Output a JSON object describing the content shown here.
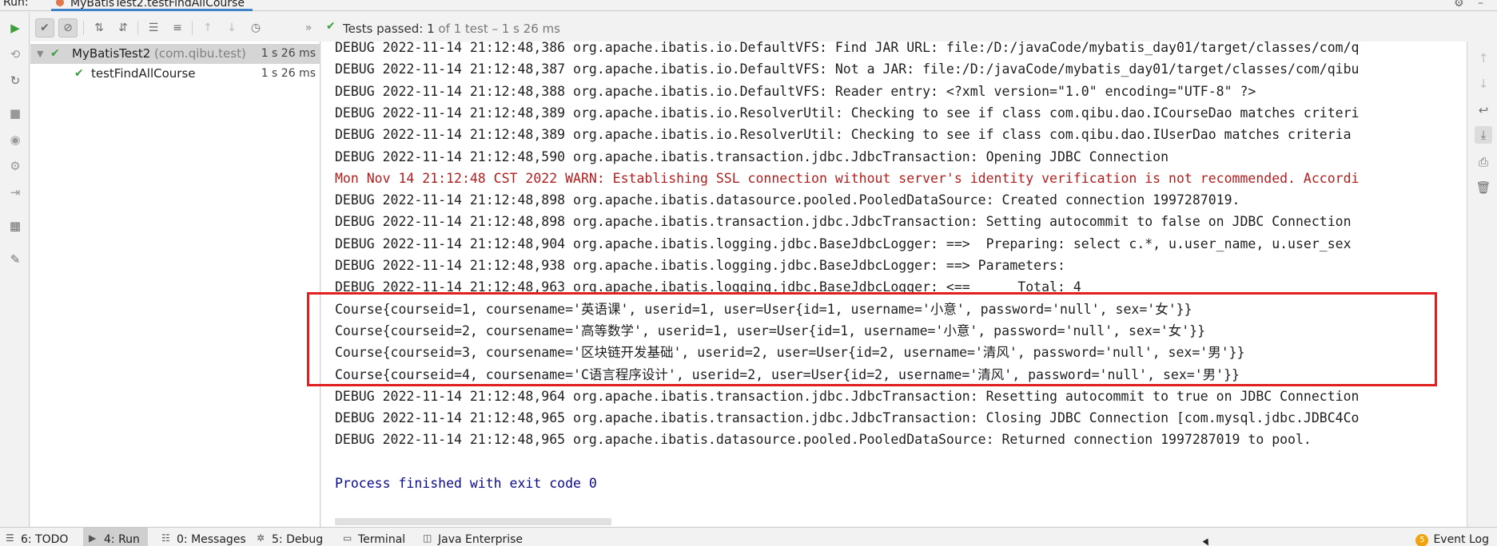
{
  "window": {
    "run_label": "Run:",
    "tab_title": "MyBatisTest2.testFindAllCourse"
  },
  "toolbar": {
    "status_prefix": "Tests passed:",
    "status_count": "1",
    "status_rest": "of 1 test – 1 s 26 ms",
    "buttons": [
      "show-passed-icon",
      "show-ignored-icon",
      "sort-alpha-icon",
      "sort-duration-icon",
      "expand-all-icon",
      "collapse-all-icon",
      "previous-failed-icon",
      "next-failed-icon",
      "test-history-icon",
      "more-icon"
    ]
  },
  "tree": {
    "root": {
      "name": "MyBatisTest2",
      "package": "(com.qibu.test)",
      "time": "1 s 26 ms"
    },
    "child": {
      "name": "testFindAllCourse",
      "time": "1 s 26 ms"
    }
  },
  "console": {
    "lines": [
      {
        "text": "DEBUG 2022-11-14 21:12:48,386 org.apache.ibatis.io.DefaultVFS: Find JAR URL: file:/D:/javaCode/mybatis_day01/target/classes/com/q",
        "kind": "normal"
      },
      {
        "text": "DEBUG 2022-11-14 21:12:48,387 org.apache.ibatis.io.DefaultVFS: Not a JAR: file:/D:/javaCode/mybatis_day01/target/classes/com/qibu",
        "kind": "normal"
      },
      {
        "text": "DEBUG 2022-11-14 21:12:48,388 org.apache.ibatis.io.DefaultVFS: Reader entry: <?xml version=\"1.0\" encoding=\"UTF-8\" ?>",
        "kind": "normal"
      },
      {
        "text": "DEBUG 2022-11-14 21:12:48,389 org.apache.ibatis.io.ResolverUtil: Checking to see if class com.qibu.dao.ICourseDao matches criteri",
        "kind": "normal"
      },
      {
        "text": "DEBUG 2022-11-14 21:12:48,389 org.apache.ibatis.io.ResolverUtil: Checking to see if class com.qibu.dao.IUserDao matches criteria",
        "kind": "normal"
      },
      {
        "text": "DEBUG 2022-11-14 21:12:48,590 org.apache.ibatis.transaction.jdbc.JdbcTransaction: Opening JDBC Connection",
        "kind": "normal"
      },
      {
        "text": "Mon Nov 14 21:12:48 CST 2022 WARN: Establishing SSL connection without server's identity verification is not recommended. Accordi",
        "kind": "warn"
      },
      {
        "text": "DEBUG 2022-11-14 21:12:48,898 org.apache.ibatis.datasource.pooled.PooledDataSource: Created connection 1997287019.",
        "kind": "normal"
      },
      {
        "text": "DEBUG 2022-11-14 21:12:48,898 org.apache.ibatis.transaction.jdbc.JdbcTransaction: Setting autocommit to false on JDBC Connection",
        "kind": "normal"
      },
      {
        "text": "DEBUG 2022-11-14 21:12:48,904 org.apache.ibatis.logging.jdbc.BaseJdbcLogger: ==>  Preparing: select c.*, u.user_name, u.user_sex",
        "kind": "normal"
      },
      {
        "text": "DEBUG 2022-11-14 21:12:48,938 org.apache.ibatis.logging.jdbc.BaseJdbcLogger: ==> Parameters: ",
        "kind": "normal"
      },
      {
        "text": "DEBUG 2022-11-14 21:12:48,963 org.apache.ibatis.logging.jdbc.BaseJdbcLogger: <==      Total: 4",
        "kind": "normal"
      },
      {
        "text": "Course{courseid=1, coursename='英语课', userid=1, user=User{id=1, username='小意', password='null', sex='女'}}",
        "kind": "normal"
      },
      {
        "text": "Course{courseid=2, coursename='高等数学', userid=1, user=User{id=1, username='小意', password='null', sex='女'}}",
        "kind": "normal"
      },
      {
        "text": "Course{courseid=3, coursename='区块链开发基础', userid=2, user=User{id=2, username='清风', password='null', sex='男'}}",
        "kind": "normal"
      },
      {
        "text": "Course{courseid=4, coursename='C语言程序设计', userid=2, user=User{id=2, username='清风', password='null', sex='男'}}",
        "kind": "normal"
      },
      {
        "text": "DEBUG 2022-11-14 21:12:48,964 org.apache.ibatis.transaction.jdbc.JdbcTransaction: Resetting autocommit to true on JDBC Connection",
        "kind": "normal"
      },
      {
        "text": "DEBUG 2022-11-14 21:12:48,965 org.apache.ibatis.transaction.jdbc.JdbcTransaction: Closing JDBC Connection [com.mysql.jdbc.JDBC4Co",
        "kind": "normal"
      },
      {
        "text": "DEBUG 2022-11-14 21:12:48,965 org.apache.ibatis.datasource.pooled.PooledDataSource: Returned connection 1997287019 to pool.",
        "kind": "normal"
      },
      {
        "text": "",
        "kind": "normal"
      },
      {
        "text": "Process finished with exit code 0",
        "kind": "exit"
      }
    ]
  },
  "bottombar": {
    "tabs": [
      {
        "label": "6: TODO",
        "icon": "todo-icon"
      },
      {
        "label": "4: Run",
        "icon": "run-icon",
        "active": true
      },
      {
        "label": "0: Messages",
        "icon": "messages-icon"
      },
      {
        "label": "5: Debug",
        "icon": "debug-icon"
      },
      {
        "label": "Terminal",
        "icon": "terminal-icon"
      },
      {
        "label": "Java Enterprise",
        "icon": "java-enterprise-icon"
      }
    ],
    "event_log": {
      "label": "Event Log",
      "badge": "5"
    }
  },
  "colors": {
    "passed_green": "#3e9d3e",
    "warn_red": "#b01f1f",
    "exit_blue": "#0a0a8c",
    "highlight_red": "#e01f1f",
    "active_tab_underline": "#4083c9"
  }
}
